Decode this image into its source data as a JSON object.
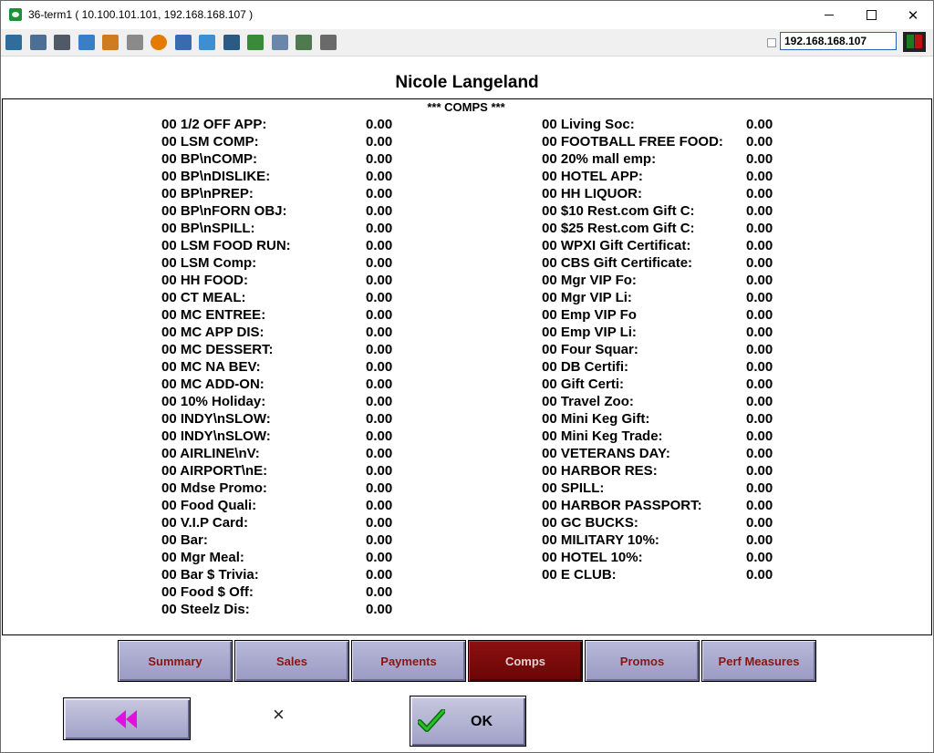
{
  "window": {
    "title": "36-term1 ( 10.100.101.101, 192.168.168.107 )"
  },
  "toolbar": {
    "icons": [
      "monitor-icon",
      "windows-icon",
      "tools-icon",
      "refresh-icon",
      "windows-logo-icon",
      "keyboard-icon",
      "alert-icon",
      "network-icon",
      "fullscreen-icon",
      "screen-icon",
      "transfer-icon",
      "document-icon",
      "map-icon",
      "display-icon"
    ],
    "ip_address": "192.168.168.107"
  },
  "header": {
    "employee_name": "Nicole Langeland",
    "section_title": "*** COMPS ***"
  },
  "comps_left": [
    {
      "label": "00 1/2 OFF APP:",
      "value": "0.00"
    },
    {
      "label": "00 LSM COMP:",
      "value": "0.00"
    },
    {
      "label": "00 BP\\nCOMP:",
      "value": "0.00"
    },
    {
      "label": "00 BP\\nDISLIKE:",
      "value": "0.00"
    },
    {
      "label": "00 BP\\nPREP:",
      "value": "0.00"
    },
    {
      "label": "00 BP\\nFORN OBJ:",
      "value": "0.00"
    },
    {
      "label": "00 BP\\nSPILL:",
      "value": "0.00"
    },
    {
      "label": "00 LSM FOOD RUN:",
      "value": "0.00"
    },
    {
      "label": "00 LSM Comp:",
      "value": "0.00"
    },
    {
      "label": "00 HH FOOD:",
      "value": "0.00"
    },
    {
      "label": "00 CT MEAL:",
      "value": "0.00"
    },
    {
      "label": "00 MC ENTREE:",
      "value": "0.00"
    },
    {
      "label": "00 MC APP DIS:",
      "value": "0.00"
    },
    {
      "label": "00 MC DESSERT:",
      "value": "0.00"
    },
    {
      "label": "00 MC NA BEV:",
      "value": "0.00"
    },
    {
      "label": "00 MC ADD-ON:",
      "value": "0.00"
    },
    {
      "label": "00 10% Holiday:",
      "value": "0.00"
    },
    {
      "label": "00 INDY\\nSLOW:",
      "value": "0.00"
    },
    {
      "label": "00 INDY\\nSLOW:",
      "value": "0.00"
    },
    {
      "label": "00 AIRLINE\\nV:",
      "value": "0.00"
    },
    {
      "label": "00 AIRPORT\\nE:",
      "value": "0.00"
    },
    {
      "label": "00 Mdse Promo:",
      "value": "0.00"
    },
    {
      "label": "00 Food Quali:",
      "value": "0.00"
    },
    {
      "label": "00 V.I.P Card:",
      "value": "0.00"
    },
    {
      "label": "00 Bar:",
      "value": "0.00"
    },
    {
      "label": "00 Mgr Meal:",
      "value": "0.00"
    },
    {
      "label": "00 Bar $ Trivia:",
      "value": "0.00"
    },
    {
      "label": "00 Food $ Off:",
      "value": "0.00"
    },
    {
      "label": "00 Steelz Dis:",
      "value": "0.00"
    }
  ],
  "comps_right": [
    {
      "label": "00 Living Soc:",
      "value": "0.00"
    },
    {
      "label": "00 FOOTBALL FREE FOOD:",
      "value": "0.00"
    },
    {
      "label": "00 20% mall emp:",
      "value": "0.00"
    },
    {
      "label": "00 HOTEL APP:",
      "value": "0.00"
    },
    {
      "label": "00 HH LIQUOR:",
      "value": "0.00"
    },
    {
      "label": "00 $10 Rest.com Gift C:",
      "value": "0.00"
    },
    {
      "label": "00 $25 Rest.com Gift C:",
      "value": "0.00"
    },
    {
      "label": "00 WPXI Gift Certificat:",
      "value": "0.00"
    },
    {
      "label": "00 CBS Gift Certificate:",
      "value": "0.00"
    },
    {
      "label": "00 Mgr VIP Fo:",
      "value": "0.00"
    },
    {
      "label": "00 Mgr VIP Li:",
      "value": "0.00"
    },
    {
      "label": "00 Emp VIP Fo",
      "value": "0.00"
    },
    {
      "label": "00 Emp VIP Li:",
      "value": "0.00"
    },
    {
      "label": "00 Four Squar:",
      "value": "0.00"
    },
    {
      "label": "00 DB Certifi:",
      "value": "0.00"
    },
    {
      "label": "00 Gift Certi:",
      "value": "0.00"
    },
    {
      "label": "00 Travel Zoo:",
      "value": "0.00"
    },
    {
      "label": "00 Mini Keg Gift:",
      "value": "0.00"
    },
    {
      "label": "00 Mini Keg Trade:",
      "value": "0.00"
    },
    {
      "label": "00 VETERANS DAY:",
      "value": "0.00"
    },
    {
      "label": "00 HARBOR RES:",
      "value": "0.00"
    },
    {
      "label": "00 SPILL:",
      "value": "0.00"
    },
    {
      "label": "00 HARBOR PASSPORT:",
      "value": "0.00"
    },
    {
      "label": "00 GC BUCKS:",
      "value": "0.00"
    },
    {
      "label": "00 MILITARY 10%:",
      "value": "0.00"
    },
    {
      "label": "00 HOTEL 10%:",
      "value": "0.00"
    },
    {
      "label": "00 E CLUB:",
      "value": "0.00"
    }
  ],
  "tabs": [
    {
      "label": "Summary",
      "active": false
    },
    {
      "label": "Sales",
      "active": false
    },
    {
      "label": "Payments",
      "active": false
    },
    {
      "label": "Comps",
      "active": true
    },
    {
      "label": "Promos",
      "active": false
    },
    {
      "label": "Perf Measures",
      "active": false
    }
  ],
  "footer": {
    "ok_label": "OK",
    "close_glyph": "×"
  },
  "colors": {
    "tab_active": "#7a0a0a",
    "tab_text": "#8a1515",
    "button_face": "#b4b4d4",
    "back_arrow": "#e010e0",
    "ok_check": "#1aa31a"
  }
}
